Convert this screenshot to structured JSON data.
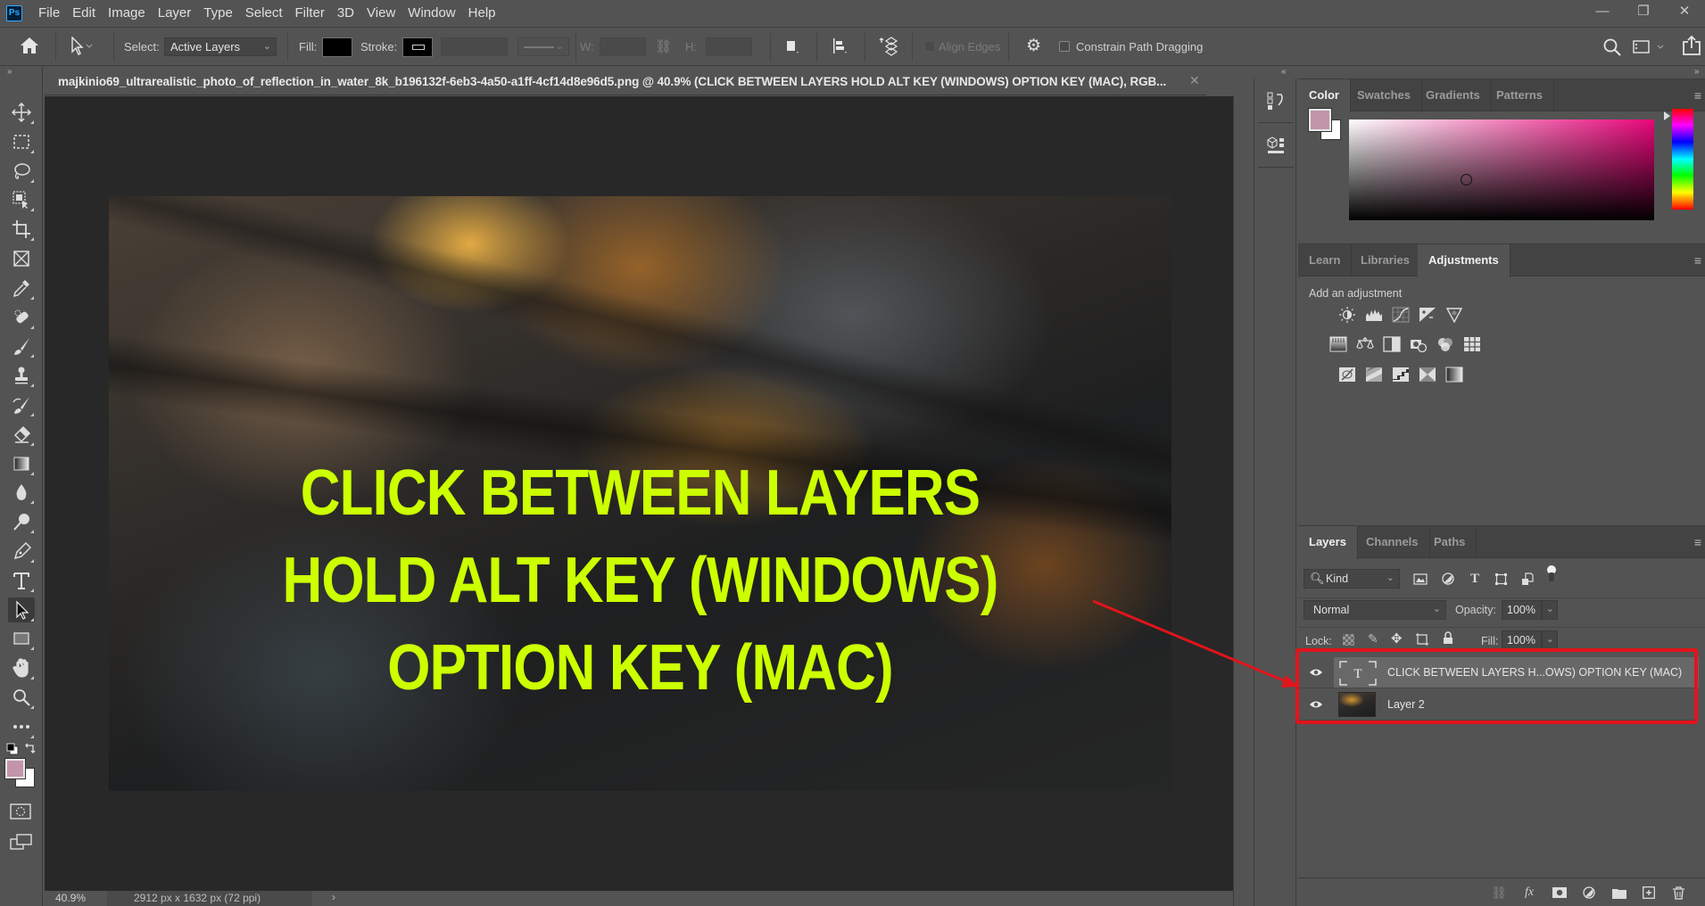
{
  "app": {
    "logo": "Ps",
    "menu": [
      "File",
      "Edit",
      "Image",
      "Layer",
      "Type",
      "Select",
      "Filter",
      "3D",
      "View",
      "Window",
      "Help"
    ],
    "window_controls": {
      "minimize": "—",
      "restore": "❐",
      "close": "✕"
    }
  },
  "options_bar": {
    "select_label": "Select:",
    "select_value": "Active Layers",
    "fill_label": "Fill:",
    "fill_color": "#000000",
    "stroke_label": "Stroke:",
    "w_label": "W:",
    "h_label": "H:",
    "w_value": "",
    "h_value": "",
    "align_edges_label": "Align Edges",
    "align_edges_checked": false,
    "constrain_label": "Constrain Path Dragging",
    "constrain_checked": false
  },
  "toolbar": {
    "tools": [
      {
        "name": "move-tool"
      },
      {
        "name": "rectangular-marquee-tool"
      },
      {
        "name": "lasso-tool"
      },
      {
        "name": "object-selection-tool"
      },
      {
        "name": "crop-tool"
      },
      {
        "name": "frame-tool"
      },
      {
        "name": "eyedropper-tool"
      },
      {
        "name": "spot-healing-tool"
      },
      {
        "name": "brush-tool"
      },
      {
        "name": "clone-stamp-tool"
      },
      {
        "name": "history-brush-tool"
      },
      {
        "name": "eraser-tool"
      },
      {
        "name": "gradient-tool"
      },
      {
        "name": "blur-tool"
      },
      {
        "name": "dodge-tool"
      },
      {
        "name": "pen-tool"
      },
      {
        "name": "type-tool"
      },
      {
        "name": "path-selection-tool",
        "active": true
      },
      {
        "name": "rectangle-tool"
      },
      {
        "name": "hand-tool"
      },
      {
        "name": "zoom-tool"
      },
      {
        "name": "edit-toolbar"
      }
    ],
    "foreground_color": "#c395ab",
    "background_color": "#ffffff"
  },
  "document": {
    "tab_title": "majkinio69_ultrarealistic_photo_of_reflection_in_water_8k_b196132f-6eb3-4a50-a1ff-4cf14d8e96d5.png @ 40.9% (CLICK BETWEEN LAYERS HOLD ALT KEY (WINDOWS) OPTION KEY (MAC), RGB...",
    "close": "✕",
    "canvas_text": [
      "CLICK BETWEEN LAYERS",
      "HOLD ALT KEY (WINDOWS)",
      "OPTION KEY (MAC)"
    ],
    "canvas_text_color": "#ccff00",
    "annotation_color": "#e0141b"
  },
  "status_bar": {
    "zoom": "40.9%",
    "doc_info": "2912 px x 1632 px (72 ppi)",
    "arrow": "›"
  },
  "color_panel": {
    "tabs": [
      "Color",
      "Swatches",
      "Gradients",
      "Patterns"
    ],
    "active_tab": "Color",
    "foreground": "#c395ab",
    "background": "#ffffff",
    "hue_color": "#e8077a"
  },
  "adjustments_panel": {
    "tabs": [
      "Learn",
      "Libraries",
      "Adjustments"
    ],
    "active_tab": "Adjustments",
    "heading": "Add an adjustment",
    "rows": [
      [
        "brightness-contrast",
        "levels",
        "curves",
        "exposure",
        "vibrance"
      ],
      [
        "hue-saturation",
        "color-balance",
        "black-white",
        "photo-filter",
        "channel-mixer",
        "color-lookup"
      ],
      [
        "invert",
        "posterize",
        "threshold",
        "selective-color",
        "gradient-map"
      ]
    ]
  },
  "layers_panel": {
    "tabs": [
      "Layers",
      "Channels",
      "Paths"
    ],
    "active_tab": "Layers",
    "filter_kind": "Kind",
    "blend_mode": "Normal",
    "opacity_label": "Opacity:",
    "opacity": "100%",
    "lock_label": "Lock:",
    "fill_label": "Fill:",
    "fill": "100%",
    "layers": [
      {
        "name": "CLICK BETWEEN LAYERS H...OWS) OPTION KEY (MAC)",
        "type": "text",
        "visible": true,
        "selected": true
      },
      {
        "name": "Layer 2",
        "type": "image",
        "visible": true,
        "selected": false
      }
    ]
  }
}
